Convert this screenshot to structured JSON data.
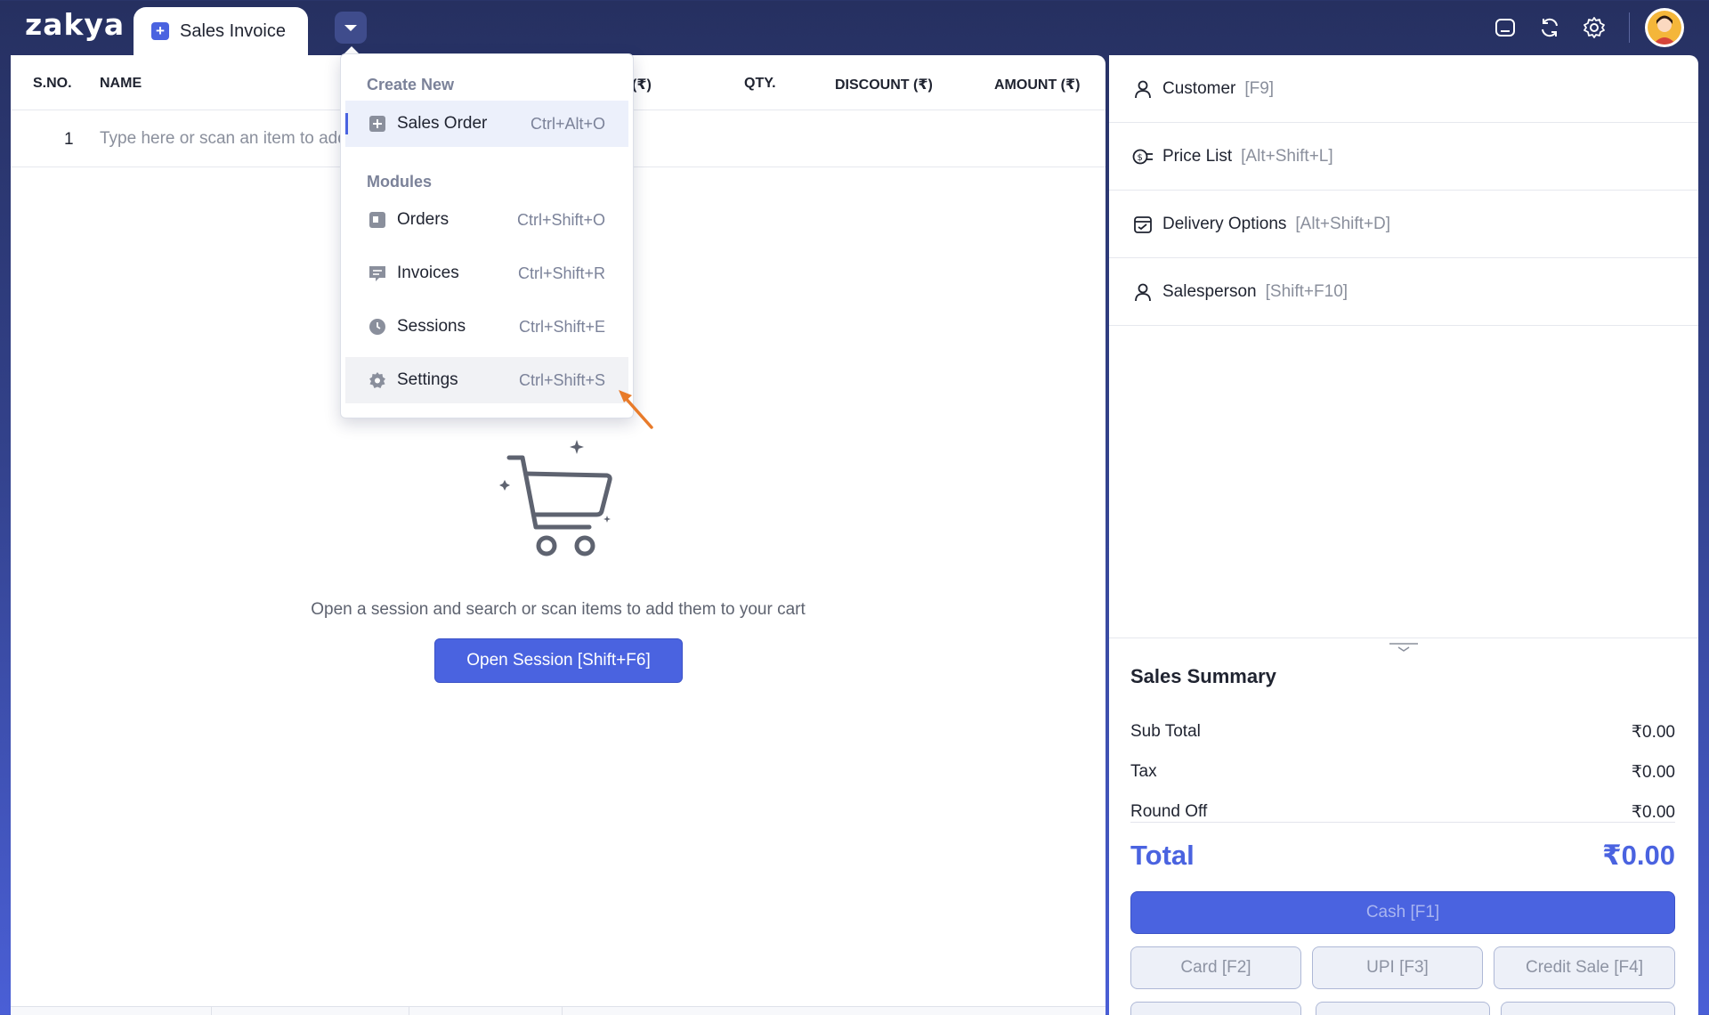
{
  "app": {
    "logo": "zakya"
  },
  "tabs": {
    "active_label": "Sales Invoice"
  },
  "table": {
    "columns": [
      "S.NO.",
      "NAME",
      "(₹)",
      "QTY.",
      "DISCOUNT (₹)",
      "AMOUNT (₹)"
    ],
    "row_number": "1",
    "item_placeholder": "Type here or scan an item to add"
  },
  "empty_state": {
    "message": "Open a session and search or scan items to add them to your cart",
    "button": "Open Session [Shift+F6]"
  },
  "options": [
    {
      "label": "Customer",
      "shortcut": "[F9]",
      "icon": "user-icon"
    },
    {
      "label": "Price List",
      "shortcut": "[Alt+Shift+L]",
      "icon": "price-list-icon"
    },
    {
      "label": "Delivery Options",
      "shortcut": "[Alt+Shift+D]",
      "icon": "delivery-icon"
    },
    {
      "label": "Salesperson",
      "shortcut": "[Shift+F10]",
      "icon": "salesperson-icon"
    }
  ],
  "summary": {
    "title": "Sales Summary",
    "sub_total_label": "Sub Total",
    "sub_total": "₹0.00",
    "tax_label": "Tax",
    "tax": "₹0.00",
    "round_off_label": "Round Off",
    "round_off": "₹0.00",
    "total_label": "Total",
    "total": "₹0.00"
  },
  "payments": {
    "cash": "Cash [F1]",
    "card": "Card [F2]",
    "upi": "UPI [F3]",
    "credit": "Credit Sale [F4]"
  },
  "menu": {
    "create_new_heading": "Create New",
    "modules_heading": "Modules",
    "sales_order": {
      "label": "Sales Order",
      "shortcut": "Ctrl+Alt+O"
    },
    "orders": {
      "label": "Orders",
      "shortcut": "Ctrl+Shift+O"
    },
    "invoices": {
      "label": "Invoices",
      "shortcut": "Ctrl+Shift+R"
    },
    "sessions": {
      "label": "Sessions",
      "shortcut": "Ctrl+Shift+E"
    },
    "settings": {
      "label": "Settings",
      "shortcut": "Ctrl+Shift+S"
    }
  },
  "colors": {
    "accent": "#4a63e0",
    "annotation_arrow": "#e87b2a",
    "topbar": "#263060"
  }
}
